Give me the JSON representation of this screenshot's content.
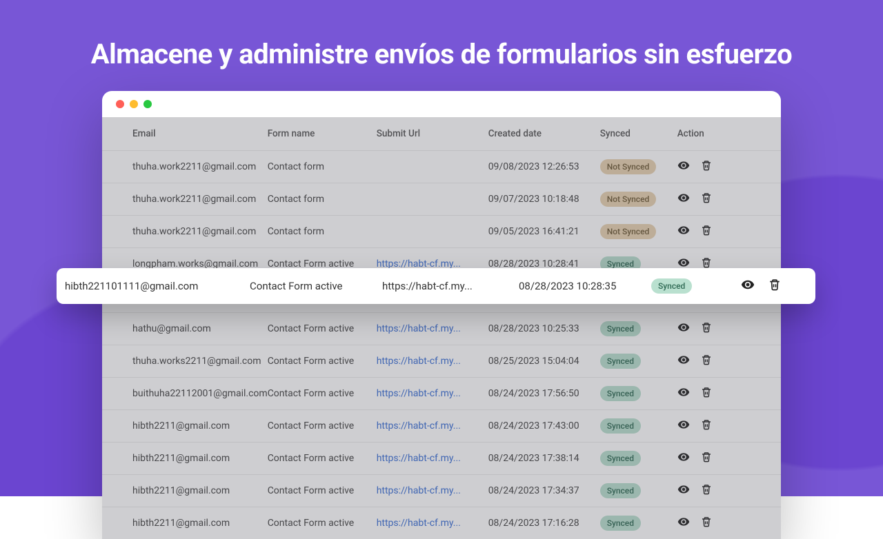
{
  "headline": "Almacene y administre envíos de formularios sin esfuerzo",
  "columns": {
    "email": "Email",
    "form": "Form name",
    "url": "Submit Url",
    "date": "Created date",
    "synced": "Synced",
    "action": "Action"
  },
  "badges": {
    "synced": "Synced",
    "not_synced": "Not Synced"
  },
  "highlighted": {
    "email": "hibth221101111@gmail.com",
    "form": "Contact Form active",
    "url": "https://habt-cf.my...",
    "date": "08/28/2023 10:28:35",
    "synced": true
  },
  "rows": [
    {
      "email": "thuha.work2211@gmail.com",
      "form": "Contact form",
      "url": "",
      "date": "09/08/2023 12:26:53",
      "synced": false
    },
    {
      "email": "thuha.work2211@gmail.com",
      "form": "Contact form",
      "url": "",
      "date": "09/07/2023 10:18:48",
      "synced": false
    },
    {
      "email": "thuha.work2211@gmail.com",
      "form": "Contact form",
      "url": "",
      "date": "09/05/2023 16:41:21",
      "synced": false
    },
    {
      "email": "longpham.works@gmail.com",
      "form": "Contact Form active",
      "url": "https://habt-cf.my...",
      "date": "08/28/2023 10:28:41",
      "synced": true
    },
    {
      "email": "",
      "form": "",
      "url": "",
      "date": "",
      "synced": true,
      "spacer": true
    },
    {
      "email": "hathu@gmail.com",
      "form": "Contact Form active",
      "url": "https://habt-cf.my...",
      "date": "08/28/2023 10:25:33",
      "synced": true
    },
    {
      "email": "thuha.works2211@gmail.com",
      "form": "Contact Form active",
      "url": "https://habt-cf.my...",
      "date": "08/25/2023 15:04:04",
      "synced": true
    },
    {
      "email": "buithuha22112001@gmail.com",
      "form": "Contact Form active",
      "url": "https://habt-cf.my...",
      "date": "08/24/2023 17:56:50",
      "synced": true
    },
    {
      "email": "hibth2211@gmail.com",
      "form": "Contact Form active",
      "url": "https://habt-cf.my...",
      "date": "08/24/2023 17:43:00",
      "synced": true
    },
    {
      "email": "hibth2211@gmail.com",
      "form": "Contact Form active",
      "url": "https://habt-cf.my...",
      "date": "08/24/2023 17:38:14",
      "synced": true
    },
    {
      "email": "hibth2211@gmail.com",
      "form": "Contact Form active",
      "url": "https://habt-cf.my...",
      "date": "08/24/2023 17:34:37",
      "synced": true
    },
    {
      "email": "hibth2211@gmail.com",
      "form": "Contact Form active",
      "url": "https://habt-cf.my...",
      "date": "08/24/2023 17:16:28",
      "synced": true
    }
  ]
}
